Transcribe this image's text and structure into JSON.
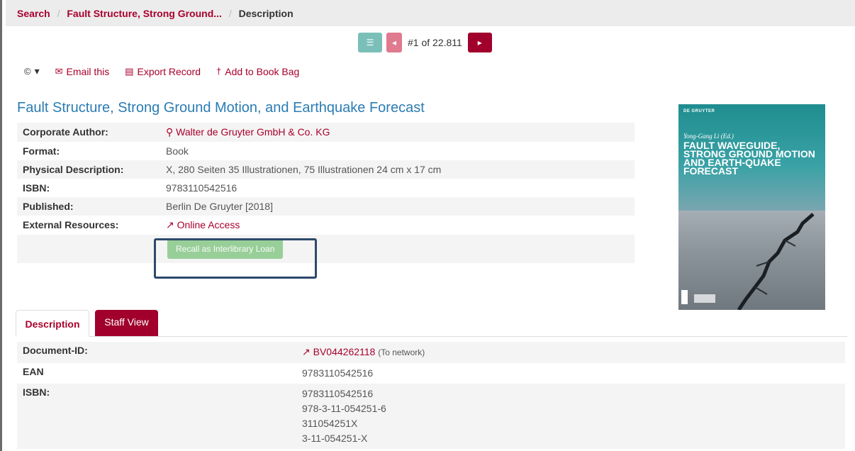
{
  "breadcrumb": {
    "search": "Search",
    "record": "Fault Structure, Strong Ground...",
    "current": "Description"
  },
  "pager": {
    "list_icon": "☰",
    "prev_icon": "◂",
    "count": "#1 of 22.811",
    "next_icon": "▸"
  },
  "toolbar": {
    "cite_icon": "©",
    "cite_caret": "▾",
    "email_icon": "✉",
    "email": "Email this",
    "export_icon": "▤",
    "export": "Export Record",
    "bookbag_icon": "†",
    "bookbag": "Add to Book Bag"
  },
  "record": {
    "title": "Fault Structure, Strong Ground Motion, and Earthquake Forecast",
    "fields": [
      {
        "label": "Corporate Author:",
        "value": "Walter de Gruyter GmbH & Co. KG"
      },
      {
        "label": "Format:",
        "value": "Book"
      },
      {
        "label": "Physical Description:",
        "value": "X, 280 Seiten 35 Illustrationen, 75 Illustrationen 24 cm x 17 cm"
      },
      {
        "label": "ISBN:",
        "value": "9783110542516"
      },
      {
        "label": "Published:",
        "value": "Berlin De Gruyter [2018]"
      },
      {
        "label": "External Resources:",
        "value": "Online Access"
      }
    ],
    "search_icon": "⚲",
    "external_icon": "↗",
    "ill_button": "Recall as Interlibrary Loan"
  },
  "cover": {
    "publisher": "DE GRUYTER",
    "author": "Yong-Gang Li (Ed.)",
    "title": "Fault Waveguide, Strong Ground Motion and Earth-quake Forecast"
  },
  "tabs": {
    "description": "Description",
    "staff_view": "Staff View"
  },
  "description": {
    "rows": [
      {
        "label": "Document-ID:",
        "value": "BV044262118",
        "note": "(To network)"
      },
      {
        "label": "EAN",
        "value": "9783110542516"
      },
      {
        "label": "ISBN:",
        "values": [
          "9783110542516",
          "978-3-11-054251-6",
          "311054251X",
          "3-11-054251-X"
        ]
      }
    ]
  }
}
